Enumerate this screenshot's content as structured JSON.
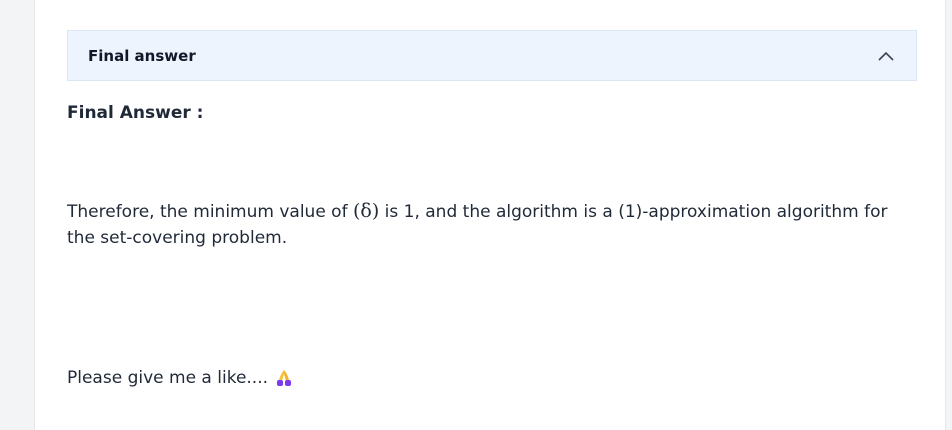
{
  "accordion": {
    "title": "Final answer",
    "expanded": true,
    "icon": "chevron-up-icon"
  },
  "content": {
    "heading": "Final Answer :",
    "sentence_before": "Therefore, the minimum value of ",
    "math_expr": "(δ)",
    "sentence_after": " is 1, and the algorithm is a (1)-approximation algorithm for the set-covering problem.",
    "closing": "Please give me a like....",
    "closing_icon": "folded-hands-emoji-icon"
  },
  "colors": {
    "header_bg": "#eef4fe",
    "text": "#1f2937",
    "emoji": "#f5c542",
    "emoji_sleeve": "#7c3aed"
  }
}
